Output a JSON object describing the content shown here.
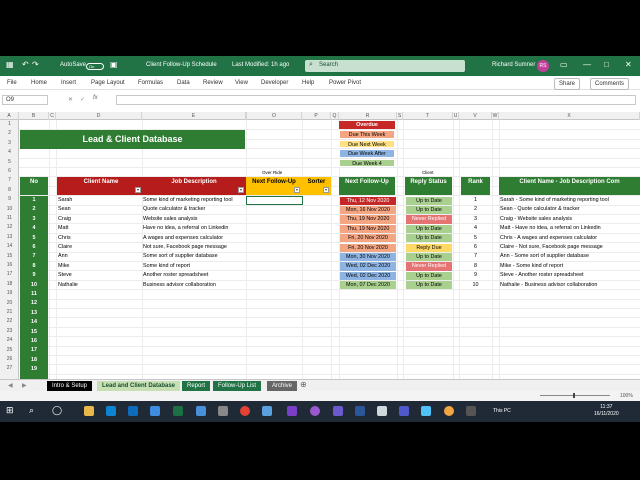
{
  "titlebar": {
    "autosave_label": "AutoSave",
    "autosave_state": "On",
    "doc_title": "Client Follow-Up Schedule",
    "last_modified": "Last Modified: 1h ago",
    "search_placeholder": "Search",
    "user_name": "Richard Sumner",
    "user_initials": "RS"
  },
  "menu": {
    "items": [
      "File",
      "Home",
      "Insert",
      "Page Layout",
      "Formulas",
      "Data",
      "Review",
      "View",
      "Developer",
      "Help",
      "Power Pivot"
    ],
    "share": "Share",
    "comments": "Comments"
  },
  "formula_bar": {
    "name_box": "O9",
    "value": ""
  },
  "columns": [
    "A",
    "B",
    "C",
    "D",
    "E",
    "",
    "O",
    "P",
    "Q",
    "R",
    "S",
    "T",
    "U",
    "V",
    "W",
    "X"
  ],
  "rows": [
    "1",
    "2",
    "3",
    "4",
    "5",
    "6",
    "7",
    "8",
    "9",
    "10",
    "11",
    "12",
    "13",
    "14",
    "15",
    "16",
    "17",
    "18",
    "19",
    "20",
    "21",
    "22",
    "23",
    "24",
    "25",
    "26",
    "27"
  ],
  "sheet": {
    "title": "Lead & Client Database",
    "override_label": "Over Ride",
    "client_label": "Client",
    "headers": {
      "no": "No",
      "client_name": "Client Name",
      "job_description": "Job Description",
      "next_follow_up_override": "Next Follow-Up",
      "sorter": "Sorter",
      "next_follow_up": "Next Follow-Up",
      "reply_status": "Reply Status",
      "rank": "Rank",
      "combined": "Client Name - Job Description Com"
    },
    "legend": {
      "overdue": "Overdue",
      "due_this_week": "Due This Week",
      "due_next_week": "Due Next Week",
      "due_week_after": "Due Week After",
      "due_week_4": "Due Week 4"
    },
    "numbers": [
      "1",
      "2",
      "3",
      "4",
      "5",
      "6",
      "7",
      "8",
      "9",
      "10",
      "11",
      "12",
      "13",
      "14",
      "15",
      "16",
      "17",
      "18",
      "19"
    ],
    "clients": [
      {
        "name": "Sarah",
        "job": "Some kind of marketing reporting tool",
        "date": "Thu, 12 Nov 2020",
        "status": "Up to Date",
        "rank": "1",
        "combined": "Sarah - Some kind of marketing reporting tool"
      },
      {
        "name": "Sean",
        "job": "Quote calculator & tracker",
        "date": "Mon, 16 Nov 2020",
        "status": "Up to Date",
        "rank": "2",
        "combined": "Sean - Quote calculator & tracker"
      },
      {
        "name": "Craig",
        "job": "Website sales analysis",
        "date": "Thu, 19 Nov 2020",
        "status": "Never Replied",
        "rank": "3",
        "combined": "Craig - Website sales analysis"
      },
      {
        "name": "Matt",
        "job": "Have no idea, a referral on Linkedin",
        "date": "Thu, 19 Nov 2020",
        "status": "Up to Date",
        "rank": "4",
        "combined": "Matt - Have no idea, a referral on Linkedin"
      },
      {
        "name": "Chris",
        "job": "A wages and expenses calculator",
        "date": "Fri, 20 Nov 2020",
        "status": "Up to Date",
        "rank": "5",
        "combined": "Chris - A wages and expenses calculator"
      },
      {
        "name": "Claire",
        "job": "Not sure, Facebook page message",
        "date": "Fri, 20 Nov 2020",
        "status": "Reply Due",
        "rank": "6",
        "combined": "Claire - Not sure, Facebook page message"
      },
      {
        "name": "Ann",
        "job": "Some sort of supplier database",
        "date": "Mon, 30 Nov 2020",
        "status": "Up to Date",
        "rank": "7",
        "combined": "Ann - Some sort of supplier database"
      },
      {
        "name": "Mike",
        "job": "Some kind of report",
        "date": "Wed, 02 Dec 2020",
        "status": "Never Replied",
        "rank": "8",
        "combined": "Mike - Some kind of report"
      },
      {
        "name": "Steve",
        "job": "Another roster spreadsheet",
        "date": "Wed, 02 Dec 2020",
        "status": "Up to Date",
        "rank": "9",
        "combined": "Steve - Another roster spreadsheet"
      },
      {
        "name": "Nathalie",
        "job": "Business advisor collaboration",
        "date": "Mon, 07 Dec 2020",
        "status": "Up to Date",
        "rank": "10",
        "combined": "Nathalie - Business advisor collaboration"
      }
    ]
  },
  "colors": {
    "excel_green": "#217346",
    "header_green": "#2e7d32",
    "overdue": "#c62828",
    "this_week": "#f4a582",
    "next_week": "#ffe082",
    "week_after": "#8db4e2",
    "week_4": "#a9d08e",
    "never_replied": "#e57373",
    "reply_due": "#ffd966"
  },
  "tabs": [
    "Intro & Setup",
    "Lead and Client Database",
    "Report",
    "Follow-Up List",
    "Archive"
  ],
  "status": {
    "zoom": "100%"
  },
  "taskbar": {
    "pc_label": "This PC",
    "time": "11:37",
    "date": "16/11/2020"
  }
}
